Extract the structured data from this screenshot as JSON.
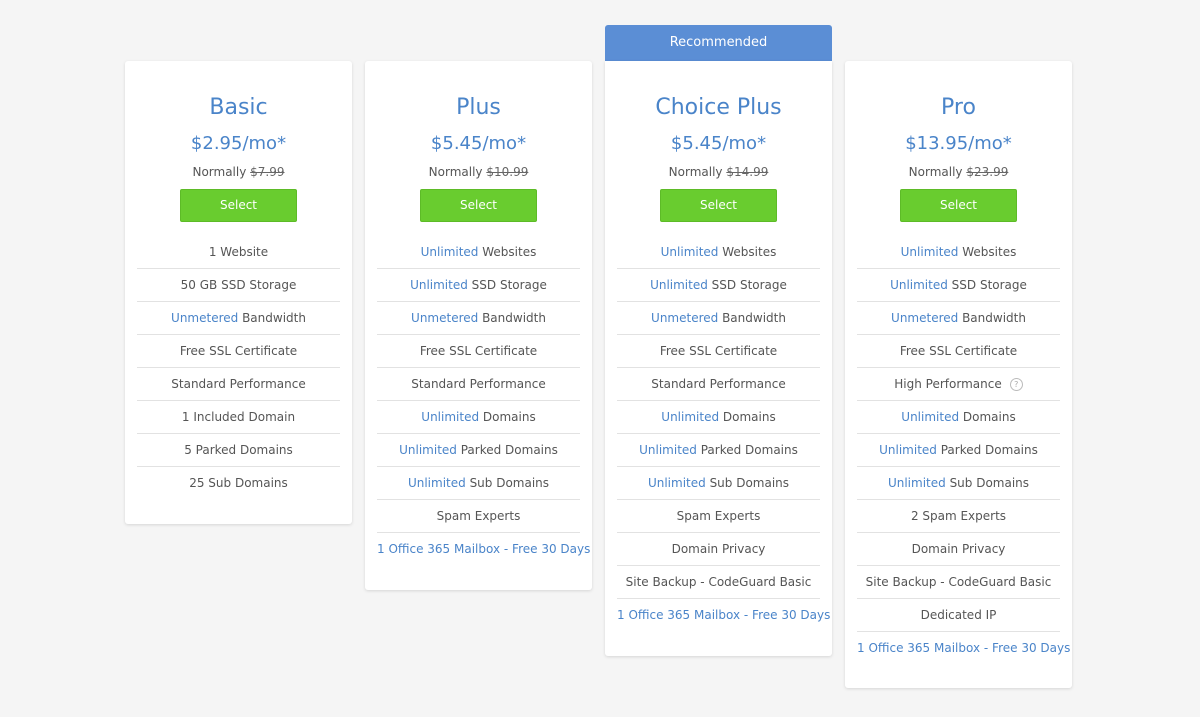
{
  "ribbon": "Recommended",
  "plans": [
    {
      "name": "Basic",
      "price": "$2.95/mo*",
      "normal_label": "Normally",
      "normal_price": "$7.99",
      "button": "Select",
      "features": [
        {
          "hl": "",
          "text": "1 Website"
        },
        {
          "hl": "",
          "text": "50 GB SSD Storage"
        },
        {
          "hl": "Unmetered",
          "text": " Bandwidth"
        },
        {
          "hl": "",
          "text": "Free SSL Certificate"
        },
        {
          "hl": "",
          "text": "Standard Performance"
        },
        {
          "hl": "",
          "text": "1 Included Domain"
        },
        {
          "hl": "",
          "text": "5 Parked Domains"
        },
        {
          "hl": "",
          "text": "25 Sub Domains"
        }
      ]
    },
    {
      "name": "Plus",
      "price": "$5.45/mo*",
      "normal_label": "Normally",
      "normal_price": "$10.99",
      "button": "Select",
      "features": [
        {
          "hl": "Unlimited",
          "text": " Websites"
        },
        {
          "hl": "Unlimited",
          "text": " SSD Storage"
        },
        {
          "hl": "Unmetered",
          "text": " Bandwidth"
        },
        {
          "hl": "",
          "text": "Free SSL Certificate"
        },
        {
          "hl": "",
          "text": "Standard Performance"
        },
        {
          "hl": "Unlimited",
          "text": " Domains"
        },
        {
          "hl": "Unlimited",
          "text": " Parked Domains"
        },
        {
          "hl": "Unlimited",
          "text": " Sub Domains"
        },
        {
          "hl": "",
          "text": "Spam Experts"
        },
        {
          "offer": "1 Office 365 Mailbox - Free 30 Days"
        }
      ]
    },
    {
      "name": "Choice Plus",
      "price": "$5.45/mo*",
      "normal_label": "Normally",
      "normal_price": "$14.99",
      "button": "Select",
      "features": [
        {
          "hl": "Unlimited",
          "text": " Websites"
        },
        {
          "hl": "Unlimited",
          "text": " SSD Storage"
        },
        {
          "hl": "Unmetered",
          "text": " Bandwidth"
        },
        {
          "hl": "",
          "text": "Free SSL Certificate"
        },
        {
          "hl": "",
          "text": "Standard Performance"
        },
        {
          "hl": "Unlimited",
          "text": " Domains"
        },
        {
          "hl": "Unlimited",
          "text": " Parked Domains"
        },
        {
          "hl": "Unlimited",
          "text": " Sub Domains"
        },
        {
          "hl": "",
          "text": "Spam Experts"
        },
        {
          "hl": "",
          "text": "Domain Privacy"
        },
        {
          "hl": "",
          "text": "Site Backup - CodeGuard Basic"
        },
        {
          "offer": "1 Office 365 Mailbox - Free 30 Days"
        }
      ]
    },
    {
      "name": "Pro",
      "price": "$13.95/mo*",
      "normal_label": "Normally",
      "normal_price": "$23.99",
      "button": "Select",
      "features": [
        {
          "hl": "Unlimited",
          "text": " Websites"
        },
        {
          "hl": "Unlimited",
          "text": " SSD Storage"
        },
        {
          "hl": "Unmetered",
          "text": " Bandwidth"
        },
        {
          "hl": "",
          "text": "Free SSL Certificate"
        },
        {
          "hl": "",
          "text": "High Performance",
          "info_icon": "?"
        },
        {
          "hl": "Unlimited",
          "text": " Domains"
        },
        {
          "hl": "Unlimited",
          "text": " Parked Domains"
        },
        {
          "hl": "Unlimited",
          "text": " Sub Domains"
        },
        {
          "hl": "",
          "text": "2 Spam Experts"
        },
        {
          "hl": "",
          "text": "Domain Privacy"
        },
        {
          "hl": "",
          "text": "Site Backup - CodeGuard Basic"
        },
        {
          "hl": "",
          "text": "Dedicated IP"
        },
        {
          "offer": "1 Office 365 Mailbox - Free 30 Days"
        }
      ]
    }
  ]
}
